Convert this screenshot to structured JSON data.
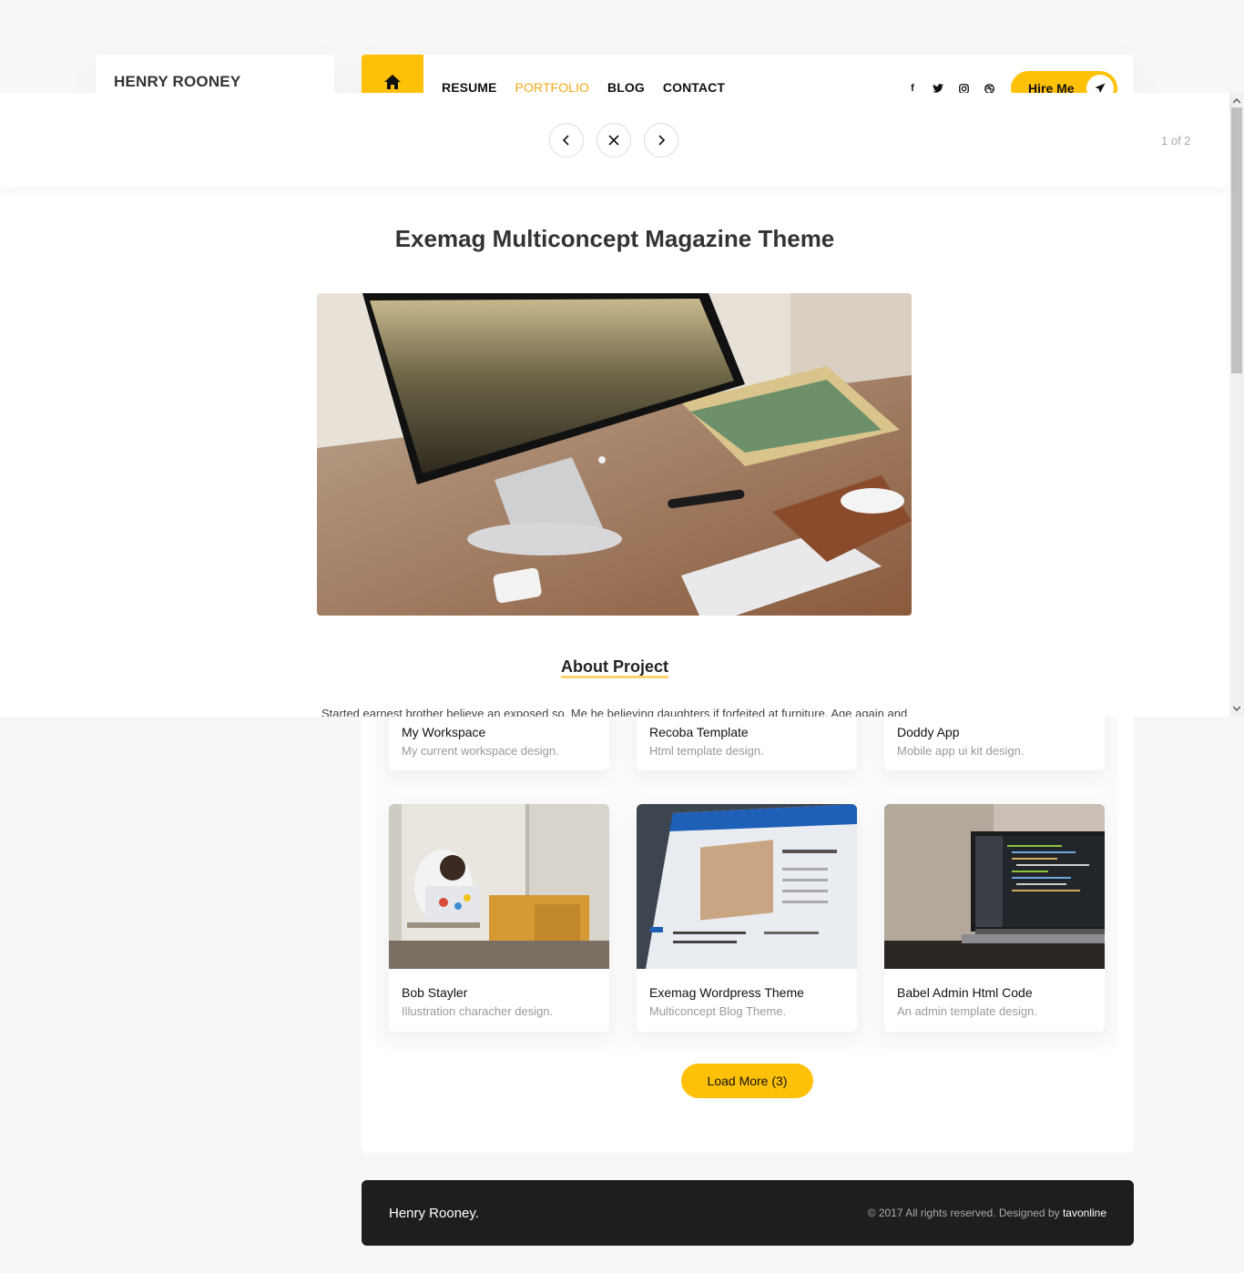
{
  "sidebar": {
    "brand_name": "HENRY ROONEY"
  },
  "header": {
    "nav": [
      "RESUME",
      "PORTFOLIO",
      "BLOG",
      "CONTACT"
    ],
    "active_nav": "PORTFOLIO",
    "socials": [
      "facebook-icon",
      "twitter-icon",
      "instagram-icon",
      "dribbble-icon"
    ],
    "hire_label": "Hire Me",
    "accent": "#ffc107"
  },
  "lightbox": {
    "counter": "1 of 2",
    "title": "Exemag Multiconcept Magazine Theme",
    "about_heading": "About Project",
    "about_text": "Started earnest brother believe an exposed so. Me he believing daughters if forfeited at furniture. Age again and"
  },
  "portfolio": {
    "items": [
      {
        "title": "My Workspace",
        "subtitle": "My current workspace design."
      },
      {
        "title": "Recoba Template",
        "subtitle": "Html template design."
      },
      {
        "title": "Doddy App",
        "subtitle": "Mobile app ui kit design."
      },
      {
        "title": "Bob Stayler",
        "subtitle": "Illustration characher design."
      },
      {
        "title": "Exemag Wordpress Theme",
        "subtitle": "Multiconcept Blog Theme."
      },
      {
        "title": "Babel Admin Html Code",
        "subtitle": "An admin template design."
      }
    ],
    "load_more": "Load More (3)"
  },
  "footer": {
    "brand": "Henry Rooney.",
    "copyright": "© 2017 All rights reserved. Designed by",
    "designer": "tavonline"
  }
}
